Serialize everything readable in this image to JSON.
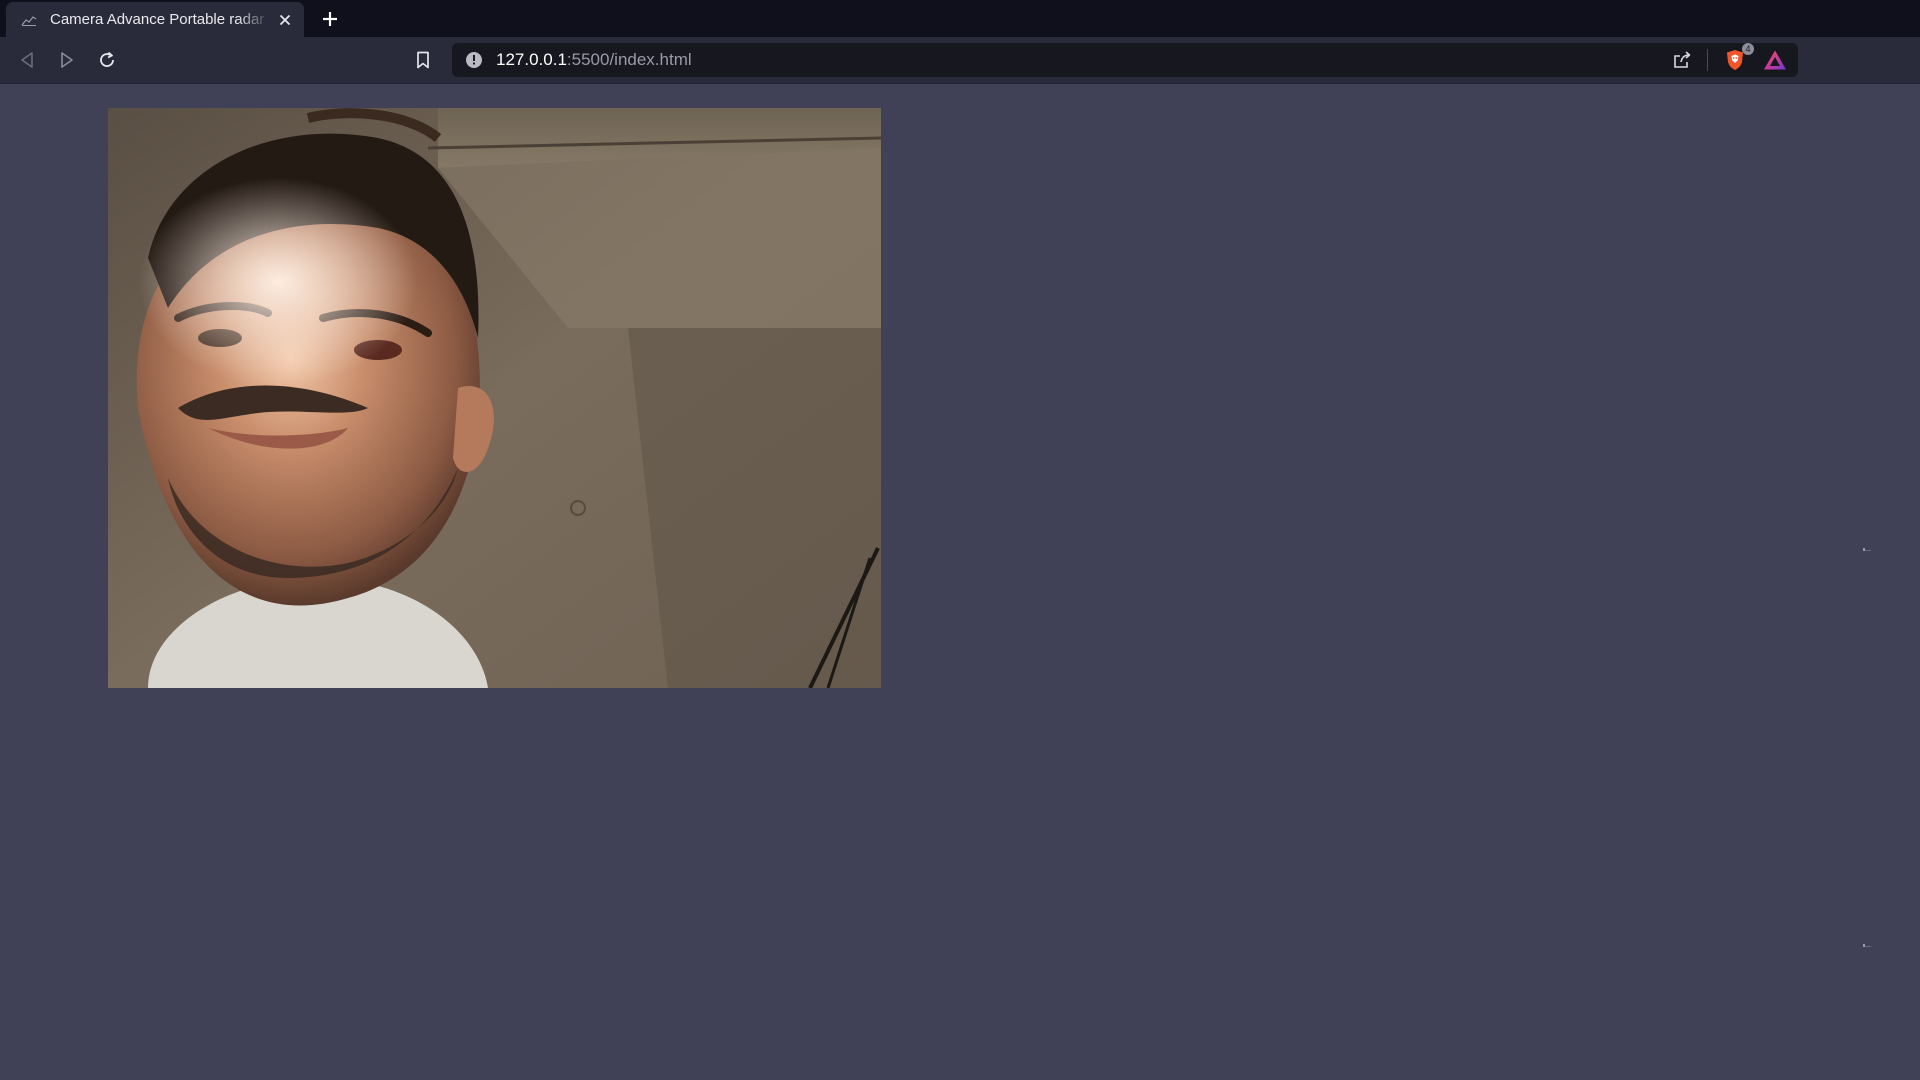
{
  "browser": {
    "tab": {
      "title": "Camera Advance Portable radar system",
      "favicon": "chart-favicon-icon",
      "close_icon": "close-icon"
    },
    "new_tab_icon": "plus-icon",
    "toolbar": {
      "back_icon": "back-arrow-icon",
      "forward_icon": "forward-arrow-icon",
      "reload_icon": "reload-icon",
      "bookmark_icon": "bookmark-icon",
      "site_info_icon": "info-icon",
      "url_host": "127.0.0.1",
      "url_rest": ":5500/index.html",
      "share_icon": "share-icon",
      "shields_icon": "brave-shield-icon",
      "shields_count": "4",
      "rewards_icon": "brave-rewards-icon"
    }
  },
  "page": {
    "background": "#404156",
    "camera_feed": {
      "description_icon": "webcam-video-feed"
    }
  },
  "colors": {
    "tabstrip": "#0f101c",
    "toolbar": "#2a2b3a",
    "urlbar": "#16171f",
    "page_bg": "#404156"
  }
}
